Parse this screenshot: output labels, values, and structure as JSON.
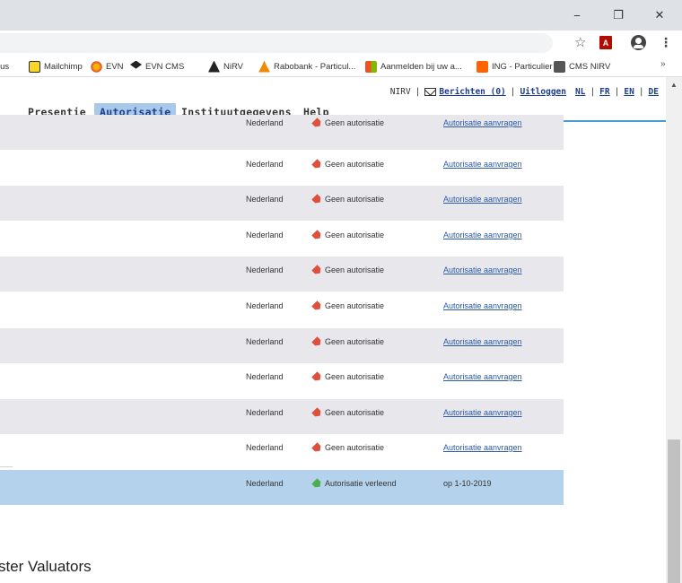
{
  "window": {
    "minimize": "−",
    "maximize": "❐",
    "close": "✕"
  },
  "addressbar": {
    "star": "☆",
    "pdf": "A",
    "menu": "⋮"
  },
  "bookmarks": [
    {
      "label": "lus",
      "icon": ""
    },
    {
      "label": "Mailchimp",
      "icon": "mailchimp-icon"
    },
    {
      "label": "EVN",
      "icon": "evn-icon"
    },
    {
      "label": "EVN CMS",
      "icon": "graduation-cap-icon"
    },
    {
      "label": "NiRV",
      "icon": "nirv-icon"
    },
    {
      "label": "Rabobank - Particul...",
      "icon": "rabobank-icon"
    },
    {
      "label": "Aanmelden bij uw a...",
      "icon": "microsoft-icon"
    },
    {
      "label": "ING - Particulier",
      "icon": "ing-icon"
    },
    {
      "label": "CMS NIRV",
      "icon": "globe-icon"
    }
  ],
  "bookmarks_more": "»",
  "toplinks": {
    "site": "NIRV",
    "berichten": "Berichten (0)",
    "uitloggen": "Uitloggen",
    "nl": "NL",
    "fr": "FR",
    "en": "EN",
    "de": "DE"
  },
  "nav": {
    "tabs": [
      "Presentie",
      "Autorisatie",
      "Instituutgegevens",
      "Help"
    ],
    "active": "Autorisatie"
  },
  "rows": [
    {
      "land": "Nederland",
      "status": "Geen autorisatie",
      "action": "Autorisatie aanvragen",
      "granted": false
    },
    {
      "land": "Nederland",
      "status": "Geen autorisatie",
      "action": "Autorisatie aanvragen",
      "granted": false
    },
    {
      "land": "Nederland",
      "status": "Geen autorisatie",
      "action": "Autorisatie aanvragen",
      "granted": false
    },
    {
      "land": "Nederland",
      "status": "Geen autorisatie",
      "action": "Autorisatie aanvragen",
      "granted": false
    },
    {
      "land": "Nederland",
      "status": "Geen autorisatie",
      "action": "Autorisatie aanvragen",
      "granted": false
    },
    {
      "land": "Nederland",
      "status": "Geen autorisatie",
      "action": "Autorisatie aanvragen",
      "granted": false
    },
    {
      "land": "Nederland",
      "status": "Geen autorisatie",
      "action": "Autorisatie aanvragen",
      "granted": false
    },
    {
      "land": "Nederland",
      "status": "Geen autorisatie",
      "action": "Autorisatie aanvragen",
      "granted": false
    },
    {
      "land": "Nederland",
      "status": "Geen autorisatie",
      "action": "Autorisatie aanvragen",
      "granted": false
    },
    {
      "land": "Nederland",
      "status": "Geen autorisatie",
      "action": "Autorisatie aanvragen",
      "granted": false
    },
    {
      "land": "Nederland",
      "status": "Autorisatie verleend",
      "action": "op 1-10-2019",
      "granted": true
    }
  ],
  "footer": "ster Valuators",
  "scrollbar": {
    "up": "▲"
  },
  "colors": {
    "accent_line": "#4a9ad8",
    "active_tab": "#a9c9ea",
    "row_grey": "#e8e8ec",
    "row_selected": "#b5d2ec",
    "link": "#2a5aa8",
    "tag_red": "#e04e3c",
    "tag_green": "#4cae4c"
  }
}
